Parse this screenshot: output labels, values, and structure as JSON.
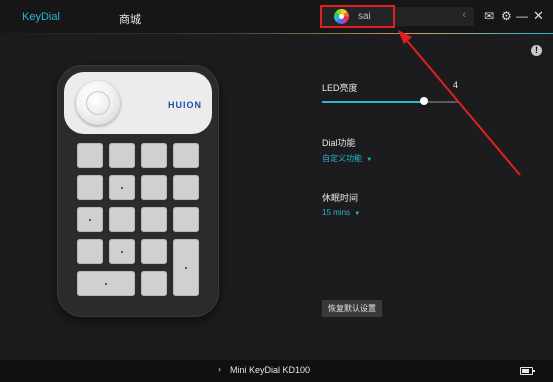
{
  "topbar": {
    "nav_keydial": "KeyDial",
    "nav_store": "商城",
    "app_selected": "sai"
  },
  "settings": {
    "led_label": "LED亮度",
    "led_value": "4",
    "led_level_fraction": 0.75,
    "dial_label": "Dial功能",
    "dial_value": "自定义功能",
    "sleep_label": "休眠时间",
    "sleep_value": "15 mins",
    "reset_label": "恢复默认设置"
  },
  "device": {
    "brand": "HUION"
  },
  "footer": {
    "device_name": "Mini KeyDial KD100"
  },
  "colors": {
    "accent": "#27b6d3",
    "highlight_box": "#e02020",
    "background": "#1c1c1e"
  }
}
